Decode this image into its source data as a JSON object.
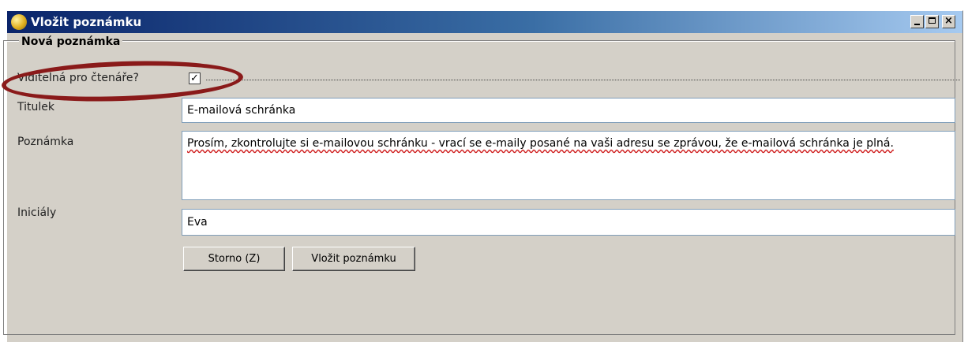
{
  "window": {
    "title": "Vložit poznámku",
    "controls": {
      "minimize": "_",
      "maximize": "□",
      "close": "×"
    }
  },
  "form": {
    "group_label": "Nová poznámka",
    "visible_label": "Viditelná pro čtenáře?",
    "visible_checked": true,
    "visible_check_glyph": "✓",
    "title_label": "Titulek",
    "title_value": "E-mailová schránka",
    "note_label": "Poznámka",
    "note_value": "Prosím, zkontrolujte si e-mailovou schránku - vrací se e-maily posané na vaši adresu se zprávou, že e-mailová schránka je plná.",
    "initials_label": "Iniciály",
    "initials_value": "Eva"
  },
  "buttons": {
    "cancel": "Storno (Z)",
    "insert": "Vložit poznámku"
  },
  "colors": {
    "title_bar_start": "#0a246a",
    "title_bar_end": "#a6caf0",
    "window_bg": "#d4d0c8",
    "highlight": "#8a1a1a"
  },
  "icons": {
    "app": "app-globe-icon"
  }
}
